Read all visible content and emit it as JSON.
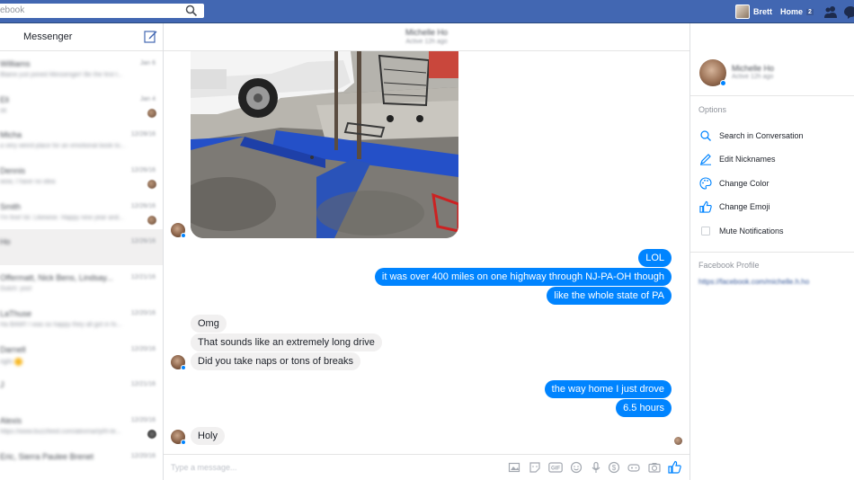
{
  "topbar": {
    "search_placeholder": "ebook",
    "user_name": "Brett",
    "home_label": "Home",
    "home_count": "2",
    "brand_color": "#4267b2"
  },
  "sidebar": {
    "title": "Messenger",
    "conversations": [
      {
        "name": "Williams",
        "snippet": "Blaine just joined Messenger! Be the first t...",
        "date": "Jan 6"
      },
      {
        "name": "Eli",
        "snippet": "ok",
        "date": "Jan 4"
      },
      {
        "name": "Micha",
        "snippet": "a very weird place for an emotional book to...",
        "date": "12/28/16"
      },
      {
        "name": "Dennis",
        "snippet": "wow, I have no idea",
        "date": "12/26/16"
      },
      {
        "name": "Smith",
        "snippet": "I'm fine! lol. Likewise. Happy new year and...",
        "date": "12/26/16"
      },
      {
        "name": "Ho",
        "snippet": "",
        "date": "12/26/16"
      },
      {
        "name": "Offermatt, Nick Bens, Lindsay...",
        "snippet": "Dutch: yoo!",
        "date": "12/21/16"
      },
      {
        "name": "LaThuse",
        "snippet": "Ha BAM!! I was so happy they all got in fo...",
        "date": "12/20/16"
      },
      {
        "name": "Darnell",
        "snippet": "right",
        "date": "12/20/16"
      },
      {
        "name": "J",
        "snippet": "",
        "date": "12/21/16"
      },
      {
        "name": "Alexis",
        "snippet": "https://www.buzzfeed.com/alexmarlyl/h-te...",
        "date": "12/20/16"
      },
      {
        "name": "Eric, Sierra Paulee Brenet",
        "snippet": "",
        "date": "12/20/16"
      }
    ]
  },
  "chat": {
    "contact_name": "Michelle Ho",
    "contact_status": "Active 12h ago",
    "messages": [
      {
        "from": "me",
        "text": "LOL"
      },
      {
        "from": "me",
        "text": "it was over 400 miles on one highway through NJ-PA-OH though"
      },
      {
        "from": "me",
        "text": "like the whole state of PA"
      },
      {
        "from": "them",
        "text": "Omg"
      },
      {
        "from": "them",
        "text": "That sounds like an extremely long drive"
      },
      {
        "from": "them",
        "text": "Did you take naps or tons of breaks"
      },
      {
        "from": "me",
        "text": "the way home I just drove"
      },
      {
        "from": "me",
        "text": "6.5 hours"
      },
      {
        "from": "them",
        "text": "Holy"
      }
    ],
    "composer_placeholder": "Type a message...",
    "bubble_color_me": "#0084ff",
    "bubble_color_them": "#f1f0f0"
  },
  "rightpanel": {
    "name": "Michelle Ho",
    "status": "Active 12h ago",
    "options_title": "Options",
    "options": [
      {
        "label": "Search in Conversation",
        "icon": "search-icon"
      },
      {
        "label": "Edit Nicknames",
        "icon": "pencil-icon"
      },
      {
        "label": "Change Color",
        "icon": "palette-icon"
      },
      {
        "label": "Change Emoji",
        "icon": "thumbs-up-icon"
      },
      {
        "label": "Mute Notifications",
        "icon": "checkbox-icon"
      }
    ],
    "profile_title": "Facebook Profile",
    "profile_link": "https://facebook.com/michelle.h.ho"
  }
}
